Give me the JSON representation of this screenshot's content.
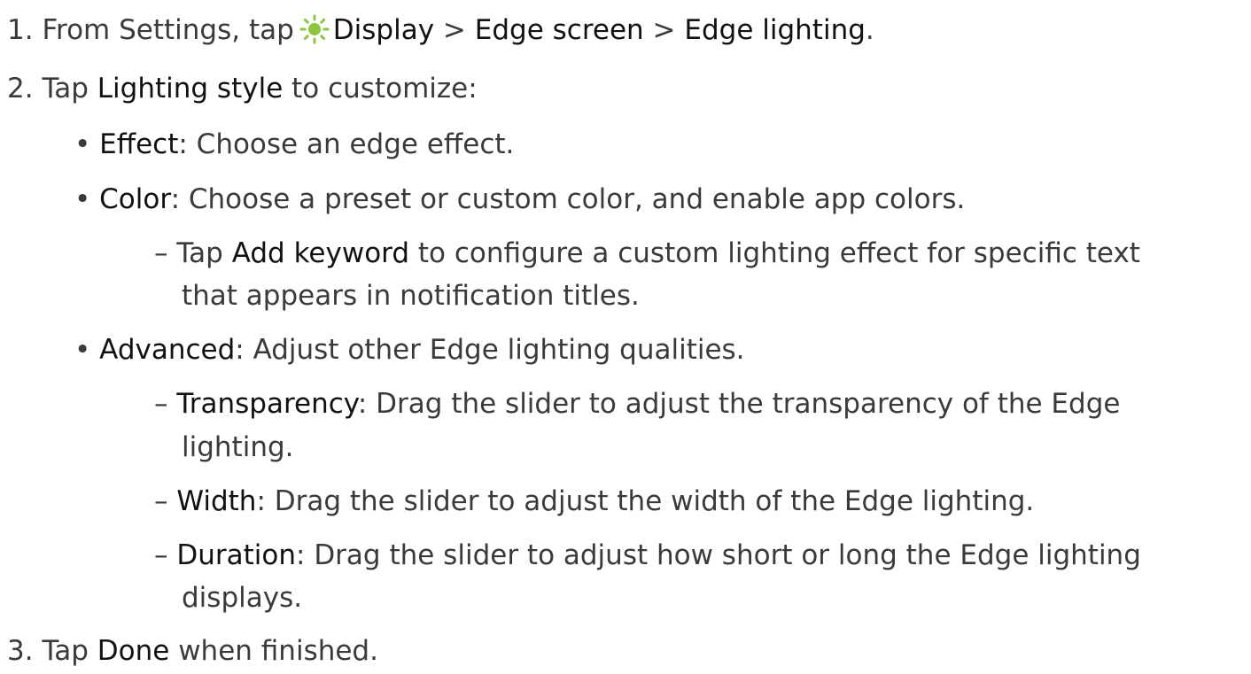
{
  "accent_color": "#8cc63f",
  "steps": [
    {
      "number": "1.",
      "pre": "From Settings, tap",
      "icon": "display-sun-icon",
      "path1": "Display",
      "sep1": ">",
      "path2": "Edge screen",
      "sep2": ">",
      "path3": "Edge lighting",
      "end": "."
    },
    {
      "number": "2.",
      "pre": "Tap",
      "term": "Lighting style",
      "post": "to customize:"
    },
    {
      "number": "3.",
      "pre": "Tap",
      "term": "Done",
      "post": "when finished."
    }
  ],
  "bullets": [
    {
      "marker": "•",
      "term": "Effect",
      "text": ": Choose an edge effect."
    },
    {
      "marker": "•",
      "term": "Color",
      "text": ": Choose a preset or custom color, and enable app colors."
    },
    {
      "marker": "•",
      "term": "Advanced",
      "text": ": Adjust other Edge lighting qualities."
    }
  ],
  "sub_items": [
    {
      "marker": "–",
      "pre": "Tap",
      "term": "Add keyword",
      "text": "to configure a custom lighting effect for specific text",
      "cont": "that appears in notification titles."
    },
    {
      "marker": "–",
      "term": "Transparency",
      "text": ": Drag the slider to adjust the transparency of the Edge",
      "cont": "lighting."
    },
    {
      "marker": "–",
      "term": "Width",
      "text": ": Drag the slider to adjust the width of the Edge lighting."
    },
    {
      "marker": "–",
      "term": "Duration",
      "text": ": Drag the slider to adjust how short or long the Edge lighting",
      "cont": "displays."
    }
  ]
}
